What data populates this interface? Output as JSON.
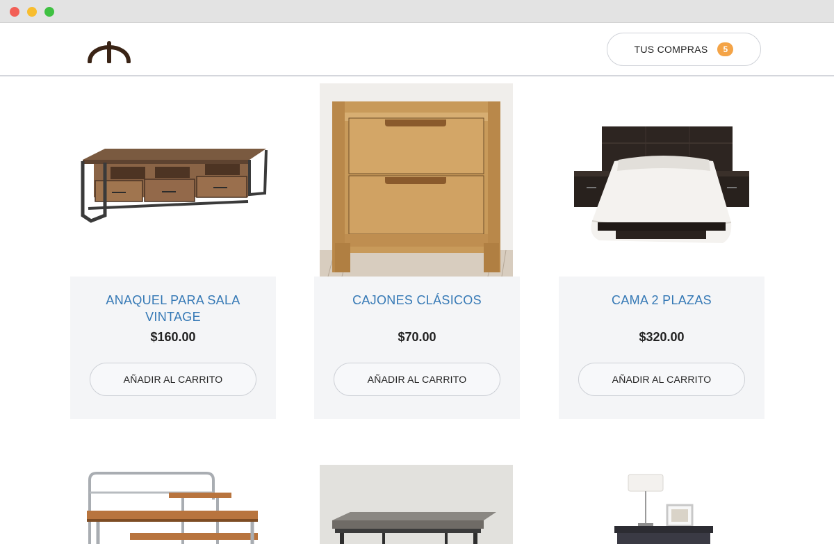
{
  "header": {
    "cart_label": "TUS COMPRAS",
    "cart_count": "5"
  },
  "products": [
    {
      "name": "ANAQUEL PARA SALA VINTAGE",
      "price": "$160.00",
      "button": "AÑADIR AL CARRITO",
      "image": "tv-stand-image"
    },
    {
      "name": "CAJONES CLÁSICOS",
      "price": "$70.00",
      "button": "AÑADIR AL CARRITO",
      "image": "nightstand-image"
    },
    {
      "name": "CAMA 2 PLAZAS",
      "price": "$320.00",
      "button": "AÑADIR AL CARRITO",
      "image": "bed-image"
    }
  ],
  "colors": {
    "accent_title": "#3478b5",
    "badge": "#f4a447",
    "card_bg": "#f4f5f7"
  }
}
